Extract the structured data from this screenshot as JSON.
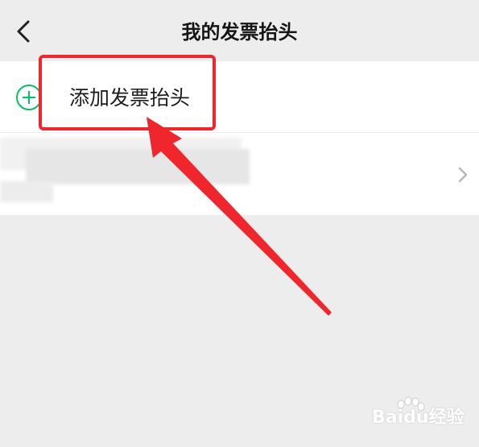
{
  "header": {
    "title": "我的发票抬头"
  },
  "list": {
    "add_label": "添加发票抬头"
  },
  "watermark": {
    "text": "Baidu经验"
  },
  "colors": {
    "background": "#ededed",
    "accent_green": "#07c160",
    "annotation_red": "#f0262d"
  },
  "icons": {
    "back": "chevron-left-icon",
    "add": "plus-circle-icon",
    "row_arrow": "chevron-right-icon"
  }
}
